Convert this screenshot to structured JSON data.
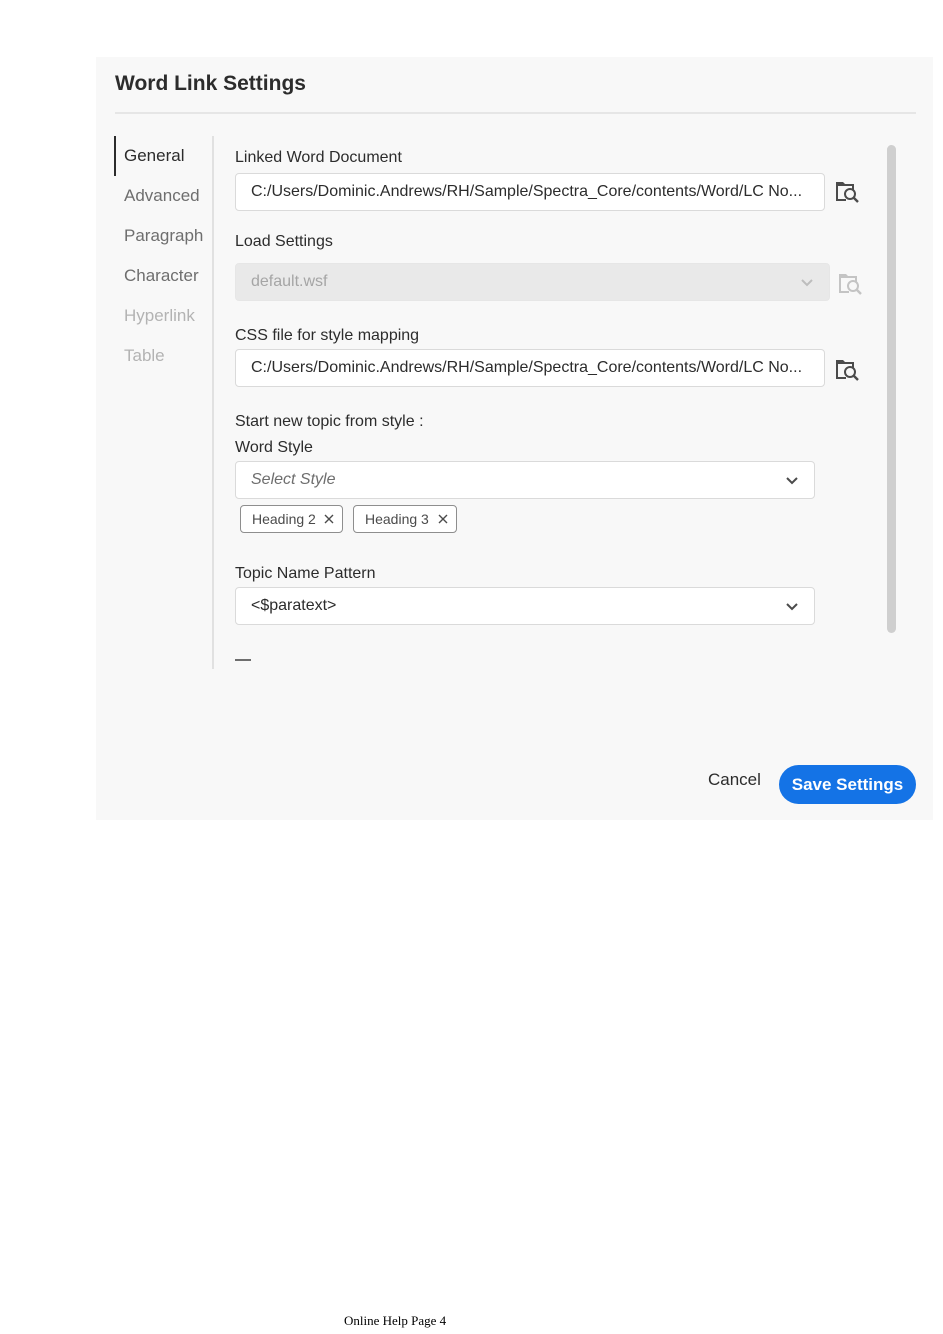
{
  "dialog": {
    "title": "Word Link Settings",
    "nav": [
      "General",
      "Advanced",
      "Paragraph",
      "Character",
      "Hyperlink",
      "Table"
    ],
    "fields": {
      "linked_doc_label": "Linked Word Document",
      "linked_doc_value": "C:/Users/Dominic.Andrews/RH/Sample/Spectra_Core/contents/Word/LC No...",
      "load_settings_label": "Load Settings",
      "load_settings_value": "default.wsf",
      "css_label": "CSS file for style mapping",
      "css_value": "C:/Users/Dominic.Andrews/RH/Sample/Spectra_Core/contents/Word/LC No...",
      "start_topic_label": "Start new topic from style :",
      "word_style_label": "Word Style",
      "word_style_placeholder": "Select Style",
      "tags": [
        "Heading 2",
        "Heading 3"
      ],
      "topic_pattern_label": "Topic Name Pattern",
      "topic_pattern_value": "<$paratext>"
    },
    "buttons": {
      "cancel": "Cancel",
      "save": "Save Settings"
    },
    "icons": {
      "browse": "folder-search-icon",
      "dropdown": "chevron-down-icon",
      "remove_tag": "close-icon"
    },
    "colors": {
      "accent": "#1473e6"
    }
  },
  "footer": {
    "page_label": "Online Help Page 4"
  }
}
